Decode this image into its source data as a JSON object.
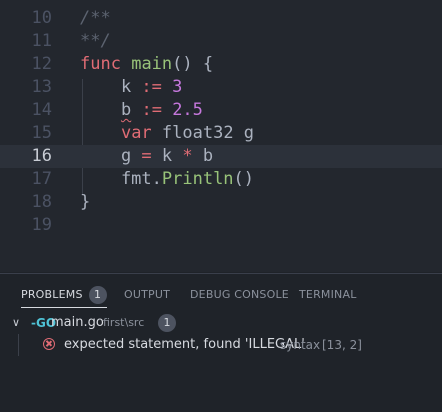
{
  "editor": {
    "lines": [
      {
        "number": "10",
        "tokens": [
          {
            "cls": "cm",
            "text": "/**"
          }
        ]
      },
      {
        "number": "11",
        "tokens": [
          {
            "cls": "cm",
            "text": "**/"
          }
        ]
      },
      {
        "number": "12",
        "tokens": [
          {
            "cls": "kw",
            "text": "func"
          },
          {
            "cls": "id",
            "text": " "
          },
          {
            "cls": "fn",
            "text": "main"
          },
          {
            "cls": "id",
            "text": "() {"
          }
        ]
      },
      {
        "number": "13",
        "tokens": [
          {
            "cls": "id",
            "text": "    k "
          },
          {
            "cls": "op",
            "text": ":="
          },
          {
            "cls": "id",
            "text": " "
          },
          {
            "cls": "num",
            "text": "3"
          }
        ]
      },
      {
        "number": "14",
        "tokens": [
          {
            "cls": "id",
            "text": "    "
          },
          {
            "cls": "id squiggle",
            "text": "b"
          },
          {
            "cls": "id",
            "text": " "
          },
          {
            "cls": "op",
            "text": ":="
          },
          {
            "cls": "id",
            "text": " "
          },
          {
            "cls": "num",
            "text": "2.5"
          }
        ]
      },
      {
        "number": "15",
        "tokens": [
          {
            "cls": "id",
            "text": "    "
          },
          {
            "cls": "kw",
            "text": "var"
          },
          {
            "cls": "id",
            "text": " float32 g"
          }
        ]
      },
      {
        "number": "16",
        "current": true,
        "tokens": [
          {
            "cls": "id",
            "text": "    g "
          },
          {
            "cls": "op",
            "text": "="
          },
          {
            "cls": "id",
            "text": " k "
          },
          {
            "cls": "op",
            "text": "*"
          },
          {
            "cls": "id",
            "text": " b"
          }
        ]
      },
      {
        "number": "17",
        "tokens": [
          {
            "cls": "id",
            "text": "    fmt."
          },
          {
            "cls": "fn",
            "text": "Println"
          },
          {
            "cls": "id",
            "text": "()"
          }
        ]
      },
      {
        "number": "18",
        "tokens": [
          {
            "cls": "id",
            "text": "}"
          }
        ]
      },
      {
        "number": "19",
        "tokens": []
      }
    ]
  },
  "panel": {
    "tabs": {
      "problems": "PROBLEMS",
      "problems_count": "1",
      "output": "OUTPUT",
      "debug_console": "DEBUG CONSOLE",
      "terminal": "TERMINAL"
    },
    "file": {
      "chevron": "∨",
      "icon": "-GO",
      "name": "main.go",
      "path": "first\\src",
      "count": "1"
    },
    "problem": {
      "message": "expected statement, found 'ILLEGAL'",
      "source": "syntax",
      "position": "[13, 2]"
    }
  },
  "colors": {
    "editor_bg": "#23272e",
    "panel_bg": "#1f2329",
    "keyword": "#e06c75",
    "function": "#98c379",
    "number": "#c678dd",
    "comment": "#5c6370",
    "error": "#e06c75",
    "go_icon": "#4fc3d6"
  }
}
